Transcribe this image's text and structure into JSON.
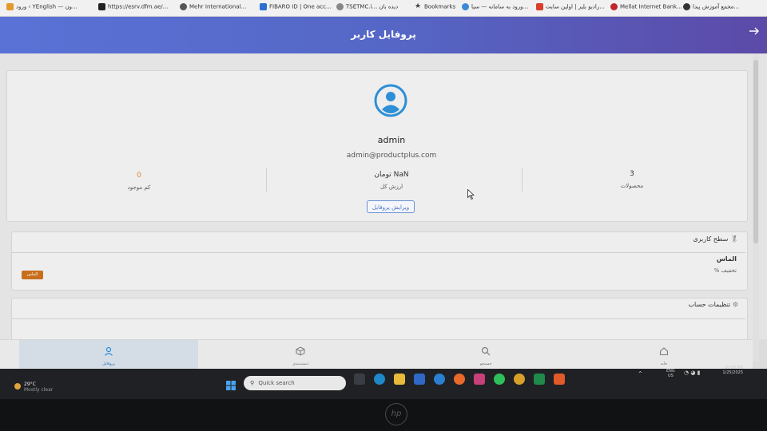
{
  "bookmarks": [
    {
      "label": "ورود ‹ YEnglish — ون...",
      "color": "#e09a2c"
    },
    {
      "label": "https://esrv.dfm.ae/...",
      "color": "#222222"
    },
    {
      "label": "Mehr International...",
      "color": "#555555"
    },
    {
      "label": "FIBARO ID | One acc...",
      "color": "#2d6fd0"
    },
    {
      "label": "TSETMC.i... دیده بان",
      "color": "#888888"
    },
    {
      "label": "Bookmarks",
      "color": "#444444"
    },
    {
      "label": "ورود به سامانه — سیا...",
      "color": "#3a8ad8"
    },
    {
      "label": "رادیو بلیر | اولین سایت...",
      "color": "#d8402c"
    },
    {
      "label": "Mellat Internet Bank...",
      "color": "#c0272d"
    },
    {
      "label": "مجمع آموزش پیدا...",
      "color": "#333333"
    }
  ],
  "header": {
    "title": "پروفایل کاربر",
    "back_icon": "arrow-right-icon"
  },
  "profile": {
    "username": "admin",
    "email": "admin@productplus.com",
    "stats": {
      "products_value": "3",
      "products_label": "محصولات",
      "total_value_value": "NaN تومان",
      "total_value_label": "ارزش کل",
      "low_stock_value": "0",
      "low_stock_label": "کم موجود"
    },
    "edit_button": "ویرایش پروفایل"
  },
  "user_level": {
    "title": "سطح کاربری",
    "level_name": "الماس",
    "discount": "تخفیف %",
    "badge": "الماس"
  },
  "account_settings": {
    "title": "تنظیمات حساب"
  },
  "bottom_nav": [
    {
      "label": "پروفایل",
      "icon": "user-icon",
      "active": true
    },
    {
      "label": "دسته‌بندی",
      "icon": "box-icon",
      "active": false
    },
    {
      "label": "جستجو",
      "icon": "search-icon",
      "active": false
    },
    {
      "label": "خانه",
      "icon": "home-icon",
      "active": false
    }
  ],
  "taskbar": {
    "search_placeholder": "Quick search",
    "weather_temp": "29°C",
    "weather_desc": "Mostly clear",
    "lang": "ENG",
    "lang_sub": "US",
    "time": "10:05 PM",
    "date": "1/25/2025"
  },
  "colors": {
    "header_start": "#5a72d6",
    "header_end": "#5c4aa8",
    "accent": "#2d8fd6",
    "badge": "#c86f1e",
    "low_stock": "#d98a2a"
  }
}
